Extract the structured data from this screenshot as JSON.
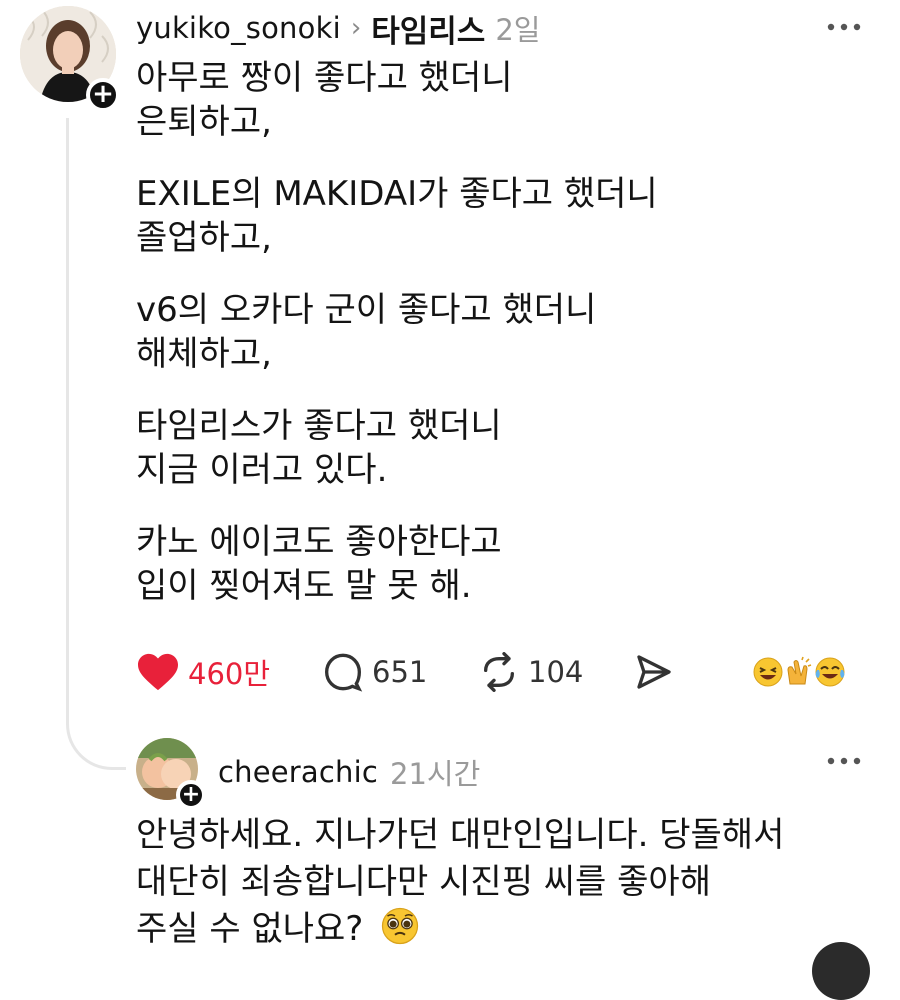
{
  "post": {
    "username": "yukiko_sonoki",
    "chevron": "›",
    "topic": "타임리스",
    "time": "2일",
    "more_icon": "more-icon",
    "paragraphs": [
      [
        "아무로 짱이 좋다고 했더니",
        "은퇴하고,"
      ],
      [
        "EXILE의 MAKIDAI가 좋다고 했더니",
        "졸업하고,"
      ],
      [
        "v6의 오카다 군이 좋다고 했더니",
        "해체하고,"
      ],
      [
        "타임리스가 좋다고 했더니",
        "지금 이러고 있다."
      ],
      [
        "카노 에이코도 좋아한다고",
        "입이 찢어져도 말 못 해."
      ]
    ],
    "actions": {
      "likes": "460만",
      "comments": "651",
      "reposts": "104"
    },
    "reaction_icons": [
      "laughing-face-icon",
      "clapping-hands-icon",
      "tears-of-joy-icon"
    ]
  },
  "reply": {
    "username": "cheerachic",
    "time": "21시간",
    "lines": [
      "안녕하세요. 지나가던 대만인입니다. 당돌해서",
      "대단히 죄송합니다만 시진핑 씨를 좋아해",
      "주실 수 없나요?"
    ],
    "emoji_icon": "pleading-face-icon"
  },
  "colors": {
    "like_red": "#e8213a",
    "text": "#141414",
    "muted": "#9a9a9a",
    "thread_line": "#e6e6e6"
  }
}
